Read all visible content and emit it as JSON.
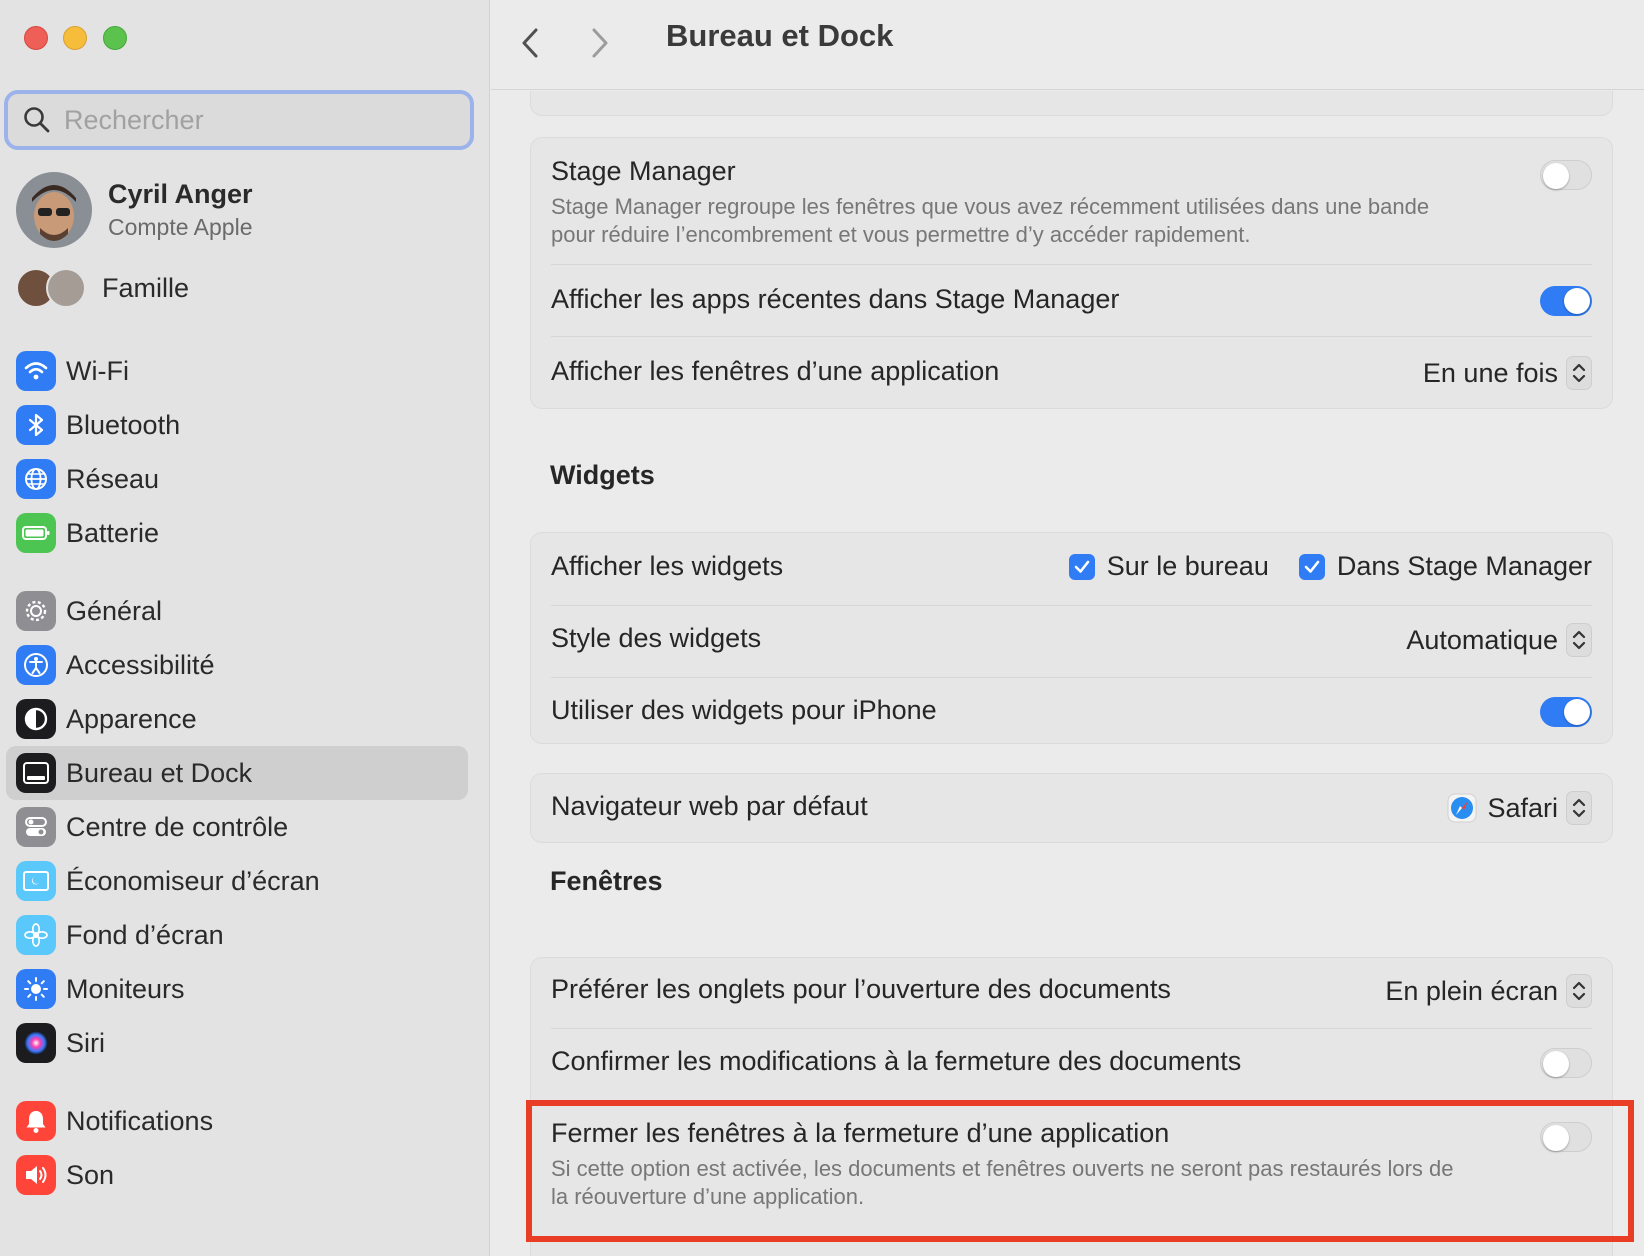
{
  "window": {
    "title": "Bureau et Dock"
  },
  "search": {
    "placeholder": "Rechercher"
  },
  "account": {
    "name": "Cyril Anger",
    "subtitle": "Compte Apple"
  },
  "family": {
    "label": "Famille"
  },
  "sidebar": {
    "items": [
      {
        "label": "Wi-Fi",
        "icon": "wifi-icon",
        "color": "#2f7cf5"
      },
      {
        "label": "Bluetooth",
        "icon": "bluetooth-icon",
        "color": "#2f7cf5"
      },
      {
        "label": "Réseau",
        "icon": "globe-icon",
        "color": "#2f7cf5"
      },
      {
        "label": "Batterie",
        "icon": "battery-icon",
        "color": "#4cc552"
      },
      {
        "label": "Général",
        "icon": "gear-icon",
        "color": "#8e8e93"
      },
      {
        "label": "Accessibilité",
        "icon": "accessibility-icon",
        "color": "#2f7cf5"
      },
      {
        "label": "Apparence",
        "icon": "appearance-icon",
        "color": "#1c1c1e"
      },
      {
        "label": "Bureau et Dock",
        "icon": "dock-icon",
        "color": "#1c1c1e",
        "selected": true
      },
      {
        "label": "Centre de contrôle",
        "icon": "control-center-icon",
        "color": "#8e8e93"
      },
      {
        "label": "Économiseur d’écran",
        "icon": "screensaver-icon",
        "color": "#5ac8fa"
      },
      {
        "label": "Fond d’écran",
        "icon": "wallpaper-icon",
        "color": "#5ac8fa"
      },
      {
        "label": "Moniteurs",
        "icon": "brightness-icon",
        "color": "#2f7cf5"
      },
      {
        "label": "Siri",
        "icon": "siri-icon",
        "color": "#1c1c1e"
      },
      {
        "label": "Notifications",
        "icon": "bell-icon",
        "color": "#ff453a"
      },
      {
        "label": "Son",
        "icon": "speaker-icon",
        "color": "#ff453a"
      }
    ]
  },
  "stage": {
    "title": "Stage Manager",
    "desc": "Stage Manager regroupe les fenêtres que vous avez récemment utilisées dans une bande pour réduire l’encombrement et vous permettre d’y accéder rapidement.",
    "stage_on": false,
    "recent_label": "Afficher les apps récentes dans Stage Manager",
    "recent_on": true,
    "windows_label": "Afficher les fenêtres d’une application",
    "windows_value": "En une fois"
  },
  "widgets": {
    "section": "Widgets",
    "show_label": "Afficher les widgets",
    "desktop": "Sur le bureau",
    "stage": "Dans Stage Manager",
    "style_label": "Style des widgets",
    "style_value": "Automatique",
    "iphone_label": "Utiliser des widgets pour iPhone",
    "iphone_on": true
  },
  "browser": {
    "label": "Navigateur web par défaut",
    "value": "Safari"
  },
  "windows": {
    "section": "Fenêtres",
    "tabs_label": "Préférer les onglets pour l’ouverture des documents",
    "tabs_value": "En plein écran",
    "confirm_label": "Confirmer les modifications à la fermeture des documents",
    "confirm_on": false,
    "close_label": "Fermer les fenêtres à la fermeture d’une application",
    "close_desc": "Si cette option est activée, les documents et fenêtres ouverts ne seront pas restaurés lors de la réouverture d’une application.",
    "close_on": false
  },
  "colors": {
    "accent": "#2f7cf5",
    "highlight": "#e93d25"
  }
}
